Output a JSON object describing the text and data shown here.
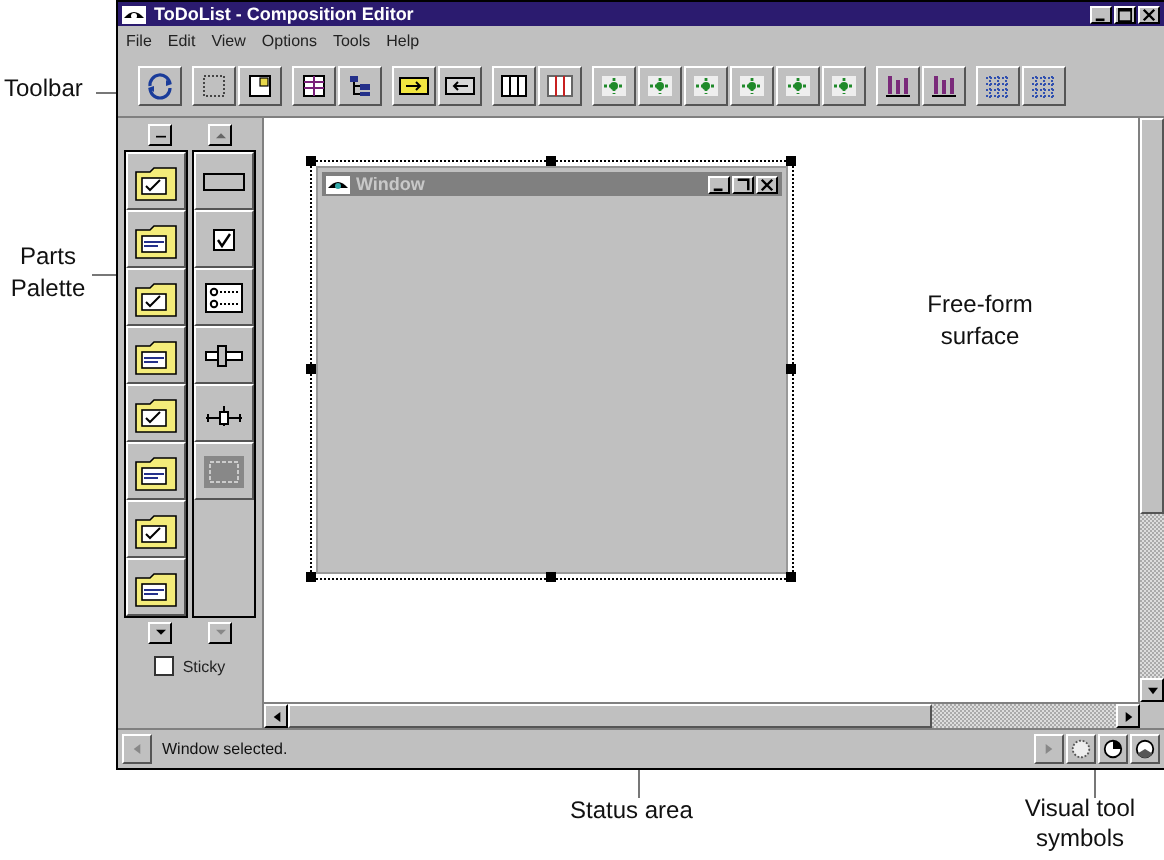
{
  "window": {
    "title": "ToDoList - Composition Editor"
  },
  "menu": [
    "File",
    "Edit",
    "View",
    "Options",
    "Tools",
    "Help"
  ],
  "palette": {
    "sticky": {
      "label": "Sticky",
      "checked": false
    }
  },
  "canvas": {
    "window_part": {
      "title": "Window",
      "selected": true
    }
  },
  "status_bar": {
    "text": "Window selected."
  },
  "callouts": {
    "toolbar": "Toolbar",
    "parts_palette": "Parts Palette",
    "free_form_surface": "Free-form surface",
    "status_area": "Status area",
    "visual_tool_symbols": "Visual tool symbols"
  }
}
